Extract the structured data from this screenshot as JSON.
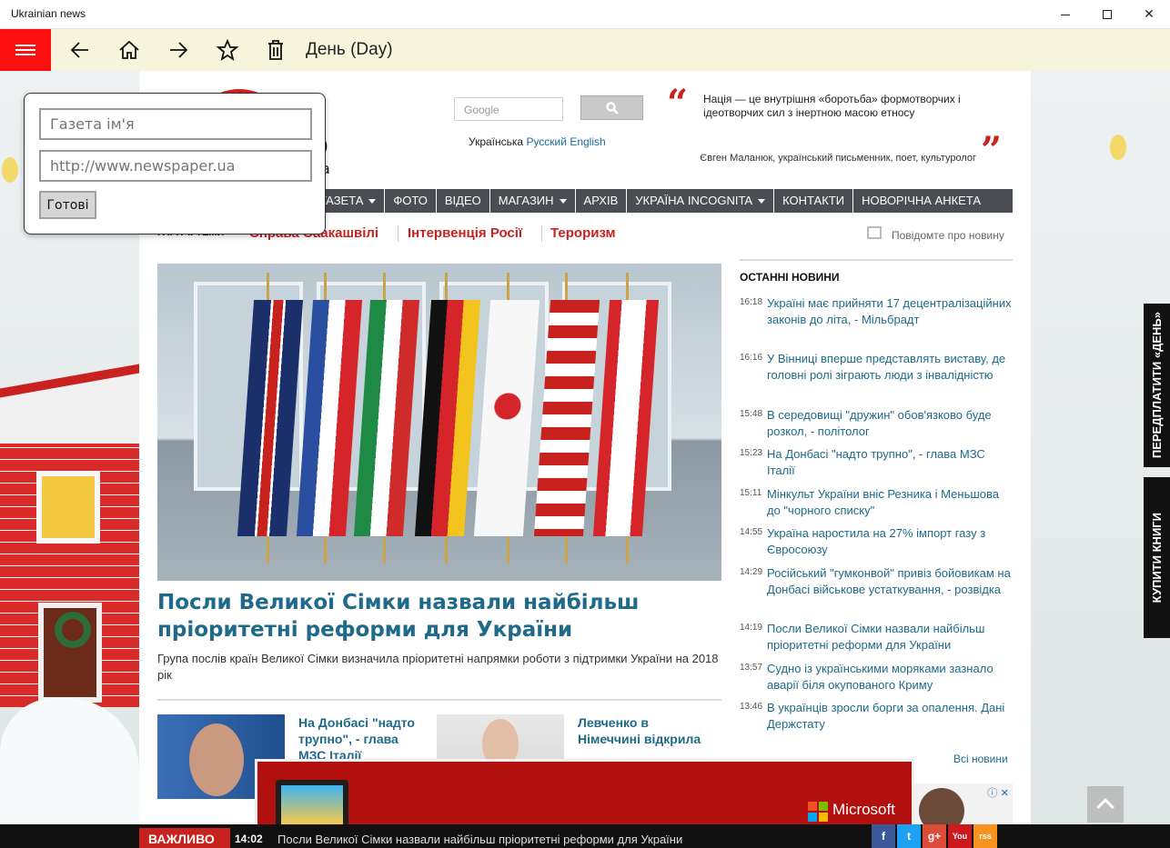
{
  "window": {
    "title": "Ukrainian news",
    "minimize": "minimize",
    "maximize": "maximize",
    "close": "✕"
  },
  "toolbar": {
    "title": "День (Day)"
  },
  "flyout": {
    "name_placeholder": "Газета ім'я",
    "url_placeholder": "http://www.newspaper.ua",
    "done_label": "Готові"
  },
  "site": {
    "logo_text": "о",
    "logo_sub": "a",
    "search_placeholder": "Google",
    "lang_ua": "Українська",
    "lang_ru": "Русский",
    "lang_en": "English",
    "quote": "Нація — це внутрішня «боротьба» формотворчих і ідеотворчих сил з інертною масою етносу",
    "quote_author": "Євген Маланюк, український письменник, поет, культуролог",
    "nav": [
      {
        "label": "ГАЗЕТА",
        "dropdown": true
      },
      {
        "label": "ФОТО",
        "dropdown": false
      },
      {
        "label": "ВІДЕО",
        "dropdown": false
      },
      {
        "label": "МАГАЗИН",
        "dropdown": true
      },
      {
        "label": "АРХІВ",
        "dropdown": false
      },
      {
        "label": "УКРАЇНА INCOGNITA",
        "dropdown": true
      },
      {
        "label": "КОНТАКТИ",
        "dropdown": false
      },
      {
        "label": "НОВОРІЧНА АНКЕТА",
        "dropdown": false
      }
    ],
    "hot_label": "ГАРЯЧІ ТЕМИ",
    "hot_topics": [
      "Справа Саакашвілі",
      "Інтервенція Росії",
      "Тероризм"
    ],
    "report_label": "Повідомте про новину",
    "hero": {
      "title": "Посли Великої Сімки назвали найбільш пріоритетні реформи для України",
      "lead": "Група послів країн Великої Сімки визначила пріоритетні напрямки роботи з підтримки України на 2018 рік"
    },
    "thumbs": [
      {
        "title": "На Донбасі \"надто трупно\", - глава МЗС Італії"
      },
      {
        "title": "Левченко в Німеччині відкрила"
      }
    ],
    "latest": {
      "heading": "ОСТАННІ НОВИНИ",
      "all_label": "Всі новини",
      "items": [
        {
          "time": "16:18",
          "text": "Україні має прийняти 17 децентралізаційних законів до літа, - Мільбрадт"
        },
        {
          "time": "16:16",
          "text": "У Вінниці вперше представлять виставу, де головні ролі зіграють люди з інвалідністю"
        },
        {
          "time": "15:48",
          "text": "В середовищі \"дружин\" обов'язково буде розкол, - політолог"
        },
        {
          "time": "15:23",
          "text": "На Донбасі \"надто трупно\", - глава МЗС Італії"
        },
        {
          "time": "15:11",
          "text": "Мінкульт України вніс Резника і Меньшова до \"чорного списку\""
        },
        {
          "time": "14:55",
          "text": "Україна наростила на 27% імпорт газу з Євросоюзу"
        },
        {
          "time": "14:29",
          "text": "Російський \"гумконвой\" привіз бойовикам на Донбасі військове устаткування, - розвідка"
        },
        {
          "time": "14:19",
          "text": "Посли Великої Сімки назвали найбільш пріоритетні реформи для України"
        },
        {
          "time": "13:57",
          "text": "Судно із українськими моряками зазнало аварії біля окупованого Криму"
        },
        {
          "time": "13:46",
          "text": "В українців зросли борги за опалення. Дані Держстату"
        }
      ]
    },
    "ad_brand": "Microsoft",
    "side_tabs": [
      "ПЕРЕДПЛАТИТИ «ДЕНЬ»",
      "КУПИТИ КНИГИ"
    ],
    "ticker": {
      "label": "ВАЖЛИВО",
      "time": "14:02",
      "text": "Посли Великої Сімки назвали найбільш пріоритетні реформи для України"
    },
    "social": [
      "f",
      "t",
      "g+",
      "You",
      "rss"
    ]
  },
  "colors": {
    "accent_red": "#ff1010",
    "link_blue": "#1f6a8a",
    "hot_red": "#c8221f",
    "nav_bg": "#4a4e52"
  }
}
